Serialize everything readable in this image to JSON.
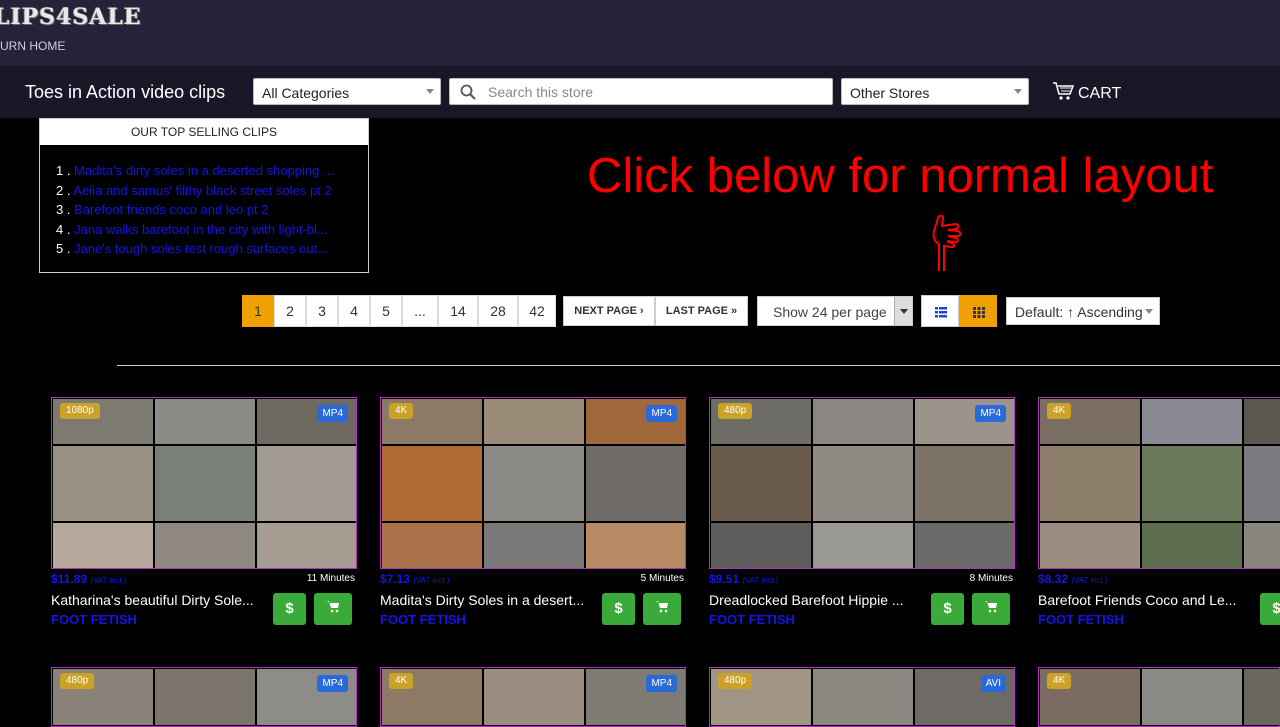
{
  "header": {
    "logo": "LIPS4SALE",
    "return_home": "URN HOME"
  },
  "storebar": {
    "store_title": "Toes in Action video clips",
    "category_select": "All Categories",
    "search_placeholder": "Search this store",
    "other_stores": "Other Stores",
    "cart_label": "CART"
  },
  "top_selling": {
    "heading": "OUR TOP SELLING CLIPS",
    "items": [
      {
        "num": "1 .",
        "title": "Madita's dirty soles in a deserted shopping ..."
      },
      {
        "num": "2 .",
        "title": "Aelia and samus' filthy black street soles pt 2"
      },
      {
        "num": "3 .",
        "title": "Barefoot friends coco and leo pt 2"
      },
      {
        "num": "4 .",
        "title": "Jana walks barefoot in the city with light-bl..."
      },
      {
        "num": "5 .",
        "title": "Jane's tough soles test rough surfaces out..."
      }
    ]
  },
  "promo": {
    "text": "Click below for normal layout"
  },
  "pagination": {
    "pages": [
      "1",
      "2",
      "3",
      "4",
      "5",
      "...",
      "14",
      "28",
      "42"
    ],
    "active": "1",
    "next_label": "NEXT PAGE ›",
    "last_label": "LAST PAGE »",
    "per_page": "Show 24 per page",
    "sort": "Default: ↑ Ascending"
  },
  "colors": {
    "accent": "#f0a000",
    "link": "#1414e6",
    "buy": "#3aaa3a",
    "promo": "#ff0000"
  },
  "clips": [
    {
      "res": "1080p",
      "format": "MP4",
      "price": "$11.89",
      "vat": "(VAT incl.)",
      "duration": "11 Minutes",
      "title": "Katharina's beautiful Dirty Sole...",
      "category": "FOOT FETISH"
    },
    {
      "res": "4K",
      "format": "MP4",
      "price": "$7.13",
      "vat": "(VAT incl.)",
      "duration": "5 Minutes",
      "title": "Madita's Dirty Soles in a desert...",
      "category": "FOOT FETISH"
    },
    {
      "res": "480p",
      "format": "MP4",
      "price": "$9.51",
      "vat": "(VAT incl.)",
      "duration": "8 Minutes",
      "title": "Dreadlocked Barefoot Hippie ...",
      "category": "FOOT FETISH"
    },
    {
      "res": "4K",
      "format": "",
      "price": "$8.32",
      "vat": "(VAT incl.)",
      "duration": "",
      "title": "Barefoot Friends Coco and Le...",
      "category": "FOOT FETISH"
    }
  ],
  "clips_row2": [
    {
      "res": "480p",
      "format": "MP4"
    },
    {
      "res": "4K",
      "format": "MP4"
    },
    {
      "res": "480p",
      "format": "AVI"
    },
    {
      "res": "4K",
      "format": ""
    }
  ],
  "buy_label": "$"
}
